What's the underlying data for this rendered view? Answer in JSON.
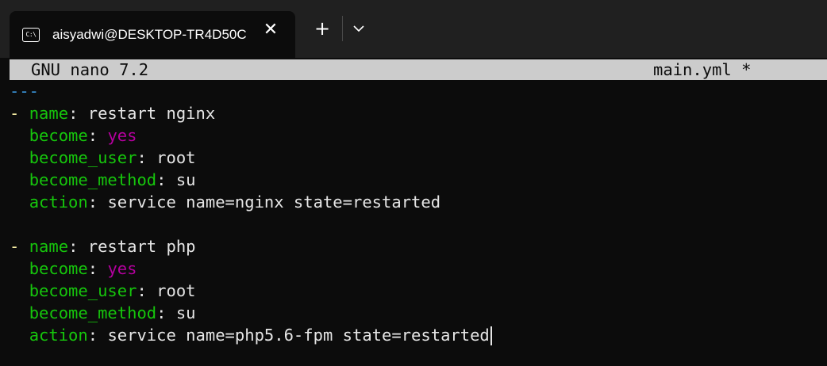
{
  "window": {
    "tab_icon_text": "C:\\",
    "tab_title": "aisyadwi@DESKTOP-TR4D50C",
    "close_glyph": "✕",
    "new_tab_glyph": "+"
  },
  "nano": {
    "version": "GNU nano 7.2",
    "filename": "main.yml *"
  },
  "colors": {
    "key": "#16c60c",
    "value": "#e6e6e6",
    "bool": "#b4009e",
    "dash": "#f9f1a5",
    "doc_marker": "#3a96dd"
  },
  "editor": {
    "doc_start": "---",
    "handler1": {
      "dash": "- ",
      "name_key": "name",
      "name_val": "restart nginx",
      "become_key": "become",
      "become_val": "yes",
      "become_user_key": "become_user",
      "become_user_val": "root",
      "become_method_key": "become_method",
      "become_method_val": "su",
      "action_key": "action",
      "action_val": "service name=nginx state=restarted"
    },
    "handler2": {
      "dash": "- ",
      "name_key": "name",
      "name_val": "restart php",
      "become_key": "become",
      "become_val": "yes",
      "become_user_key": "become_user",
      "become_user_val": "root",
      "become_method_key": "become_method",
      "become_method_val": "su",
      "action_key": "action",
      "action_val": "service name=php5.6-fpm state=restarted"
    }
  }
}
